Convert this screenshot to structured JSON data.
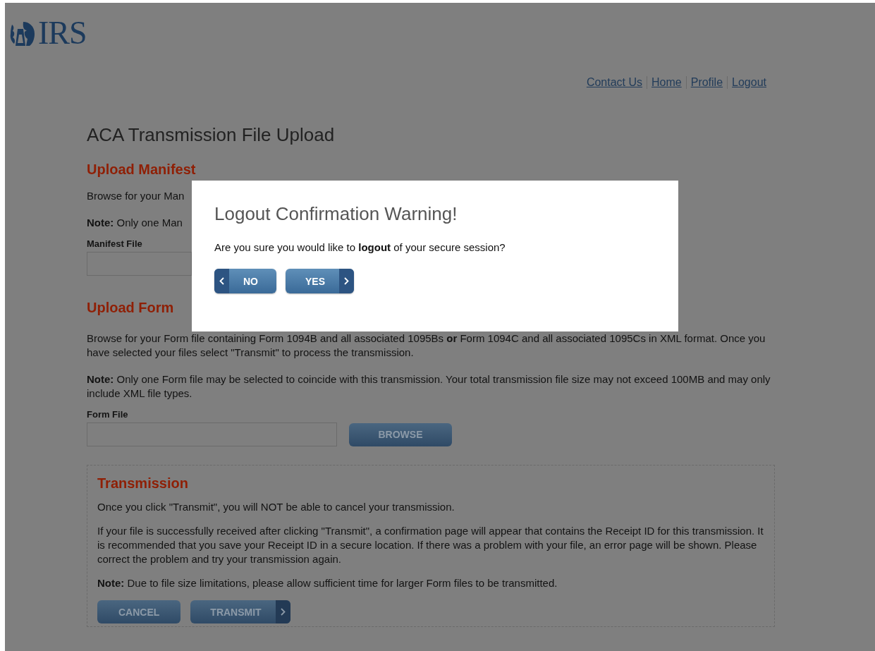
{
  "logo": {
    "text": "IRS"
  },
  "nav_links": [
    "Contact Us",
    "Home",
    "Profile",
    "Logout"
  ],
  "page_title": "ACA Transmission File Upload",
  "upload_manifest": {
    "heading": "Upload Manifest",
    "intro": "Browse for your Man",
    "note": "**Note:** Only one Man",
    "field_label": "Manifest File"
  },
  "upload_form": {
    "heading": "Upload Form",
    "intro": "Browse for your Form file containing Form 1094B and all associated 1095Bs **or** Form 1094C and all associated 1095Cs in XML format. Once you have selected your files select \"Transmit\" to process the transmission.",
    "note": "**Note:** Only one Form file may be selected to coincide with this transmission. Your total transmission file size may not exceed 100MB and may only include XML file types.",
    "field_label": "Form File",
    "browse_button": "BROWSE"
  },
  "transmission": {
    "heading": "Transmission",
    "paragraphs": [
      "Once you click \"Transmit\", you will NOT be able to cancel your transmission.",
      "If your file is successfully received after clicking \"Transmit\", a confirmation page will appear that contains the Receipt ID for this transmission. It is recommended that you save your Receipt ID in a secure location. If there was a problem with your file, an error page will be shown. Please correct the problem and try your transmission again.",
      "**Note:** Due to file size limitations, please allow sufficient time for larger Form files to be transmitted."
    ],
    "buttons": [
      {
        "label": "CANCEL",
        "kind": "plain"
      },
      {
        "label": "TRANSMIT",
        "kind": "next"
      }
    ]
  },
  "dialog": {
    "title": "Logout Confirmation Warning!",
    "message": "Are you sure you would like to **logout** of your secure session?",
    "buttons": [
      {
        "label": "NO",
        "kind": "back"
      },
      {
        "label": "YES",
        "kind": "next"
      }
    ]
  }
}
